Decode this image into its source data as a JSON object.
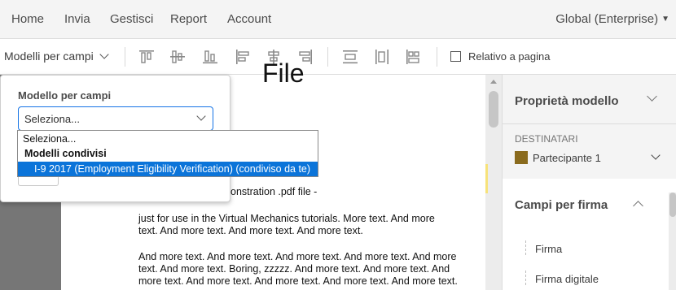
{
  "nav": {
    "items": [
      "Home",
      "Invia",
      "Gestisci",
      "Report",
      "Account"
    ],
    "account_label": "Global (Enterprise)"
  },
  "toolbar": {
    "template_dropdown_label": "Modelli per campi",
    "align_icons": [
      "align-top-icon",
      "align-middle-icon",
      "align-bottom-icon",
      "align-left-icon",
      "align-center-icon",
      "align-right-icon",
      "distribute-vertical-icon",
      "distribute-horizontal-icon",
      "size-match-icon"
    ],
    "relative_label": "Relativo a pagina",
    "relative_checked": false
  },
  "popover": {
    "label": "Modello per campi",
    "select_value": "Seleziona..."
  },
  "listbox": {
    "items": [
      {
        "text": "Seleziona...",
        "kind": "option"
      },
      {
        "text": "Modelli condivisi",
        "kind": "group"
      },
      {
        "text": "I-9 2017 (Employment Eligibility Verification) (condiviso da te)",
        "kind": "selected"
      }
    ]
  },
  "document": {
    "heading": "File",
    "partial_line": "onstration .pdf file -",
    "lines": [
      "just for use in the Virtual Mechanics tutorials. More text. And more",
      "text. And more text. And more text. And more text.",
      "And more text. And more text. And more text. And more text. And more",
      "text. And more text. Boring, zzzzz. And more text. And more text. And",
      "more text. And more text. And more text. And more text. And more text."
    ]
  },
  "right_panel": {
    "title": "Proprietà modello",
    "recipients_header": "DESTINATARI",
    "recipient_name": "Partecipante 1",
    "recipient_color": "#8a6b1e",
    "fields_title": "Campi per firma",
    "fields": [
      "Firma",
      "Firma digitale"
    ]
  }
}
